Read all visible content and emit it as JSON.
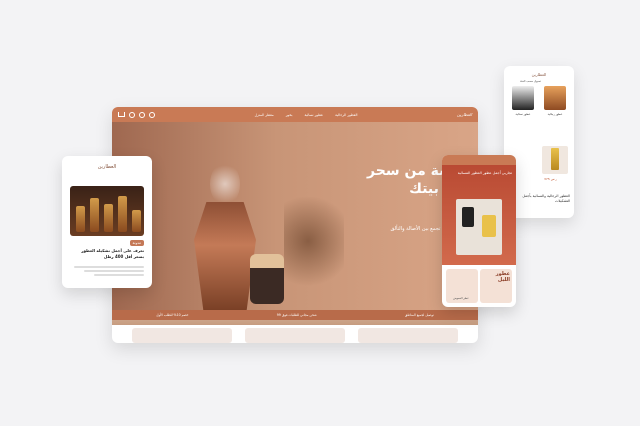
{
  "brand": {
    "logo": "العطارين"
  },
  "desktop": {
    "nav_links": [
      "العطور الرجالية",
      "عطور نسائية",
      "بخور",
      "معطر المنزل"
    ],
    "hero_title": "لمسة من سحر إلى بيتك",
    "hero_subtitle": "عطور فاخرة تجمع بين الأصالة والتألق",
    "ticker": [
      "توصيل لجميع المناطق",
      "شحن مجاني للطلبات فوق 99",
      "خصم 10% للطلب الأول"
    ],
    "colors": {
      "accent": "#c97a55",
      "hero_dark": "#9f6850",
      "hero_light": "#d9a587"
    }
  },
  "phone_left": {
    "logo": "العطارين",
    "tag": "مدونة",
    "headline": "تعرف على أجمل تشكيلة العطور بسعر أقل 400 رطل",
    "icon": "perfume-bottles-image"
  },
  "phone_right": {
    "banner_text": "تجاربي أجمل عطور العطور المسائية",
    "card_title": "عطور الليل",
    "card_label": "عطر الغموض"
  },
  "phone_top": {
    "logo": "العطارين",
    "top_label": "تسوق حسب الفئة",
    "tile_labels": [
      "عطور نسائية",
      "عطور رجالية"
    ],
    "price": "375 ر.س",
    "footer_text": "العطور الرجالية والنسائية بأجمل التشكيلات"
  }
}
